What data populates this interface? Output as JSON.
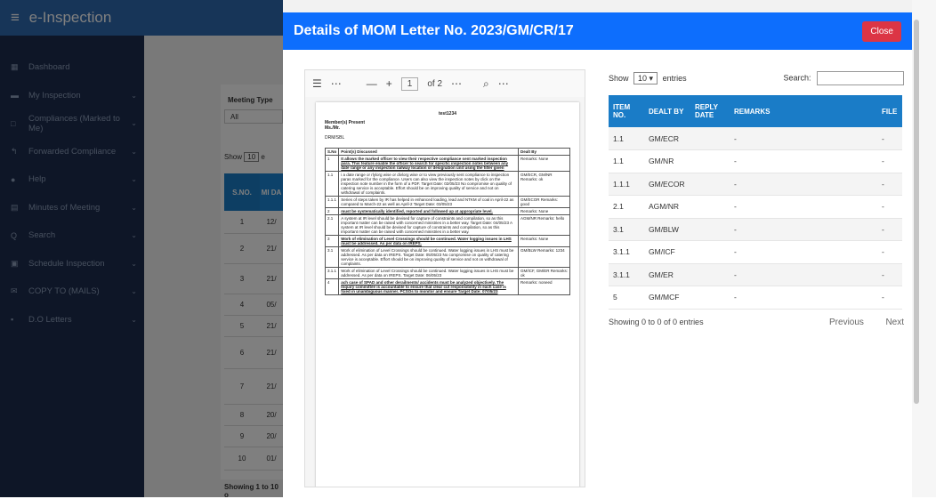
{
  "app": {
    "title": "e-Inspection",
    "menu_glyph": "≡"
  },
  "sidebar": {
    "items": [
      {
        "label": "Dashboard",
        "icon": "▦",
        "chevron": ""
      },
      {
        "label": "My Inspection",
        "icon": "▬",
        "chevron": "⌄"
      },
      {
        "label": "Compliances (Marked to Me)",
        "icon": "□",
        "chevron": "⌄"
      },
      {
        "label": "Forwarded Compliance",
        "icon": "↰",
        "chevron": "⌄"
      },
      {
        "label": "Help",
        "icon": "●",
        "chevron": "⌄"
      },
      {
        "label": "Minutes of Meeting",
        "icon": "▤",
        "chevron": "⌄"
      },
      {
        "label": "Search",
        "icon": "Q",
        "chevron": "⌄"
      },
      {
        "label": "Schedule Inspection",
        "icon": "▣",
        "chevron": "⌄"
      },
      {
        "label": "COPY TO (MAILS)",
        "icon": "✉",
        "chevron": "⌄"
      },
      {
        "label": "D.O Letters",
        "icon": "▪",
        "chevron": "⌄"
      }
    ]
  },
  "background": {
    "meeting_type_label": "Meeting Type",
    "meeting_type_value": "All",
    "show_label": "Show",
    "show_value": "10",
    "show_suffix": "e",
    "col_sno": "S.NO.",
    "col_meeting": "MI DA",
    "rows": [
      {
        "sno": "1",
        "date": "12/"
      },
      {
        "sno": "2",
        "date": "21/"
      },
      {
        "sno": "3",
        "date": "21/"
      },
      {
        "sno": "4",
        "date": "05/"
      },
      {
        "sno": "5",
        "date": "21/"
      },
      {
        "sno": "6",
        "date": "21/"
      },
      {
        "sno": "7",
        "date": "21/"
      },
      {
        "sno": "8",
        "date": "20/"
      },
      {
        "sno": "9",
        "date": "20/"
      },
      {
        "sno": "10",
        "date": "01/"
      }
    ],
    "footer": "Showing 1 to 10 o"
  },
  "modal": {
    "title": "Details of MOM Letter No. 2023/GM/CR/17",
    "close_label": "Close"
  },
  "pdf": {
    "page_value": "1",
    "page_total": "of 2",
    "doc_title": "test1234",
    "members_label": "Member(s) Present",
    "members_value": "Ms./Mr.",
    "dist": "DRM/SBL",
    "col_sno": "S.No",
    "col_points": "Point(s) Discussed",
    "col_dealt": "Dealt By",
    "rows": [
      {
        "no": "1",
        "text": "It allows the marked officer to view their respective compliance sent marked inspection para. This feature enable the officer to search for specific inspection notes between any date range or any inspection railway location or designation unit using the filter given",
        "dealt": "Remarks: None",
        "u": true
      },
      {
        "no": "1.1",
        "text": "i a date range or rlylorg wise or divlorg wise or to view previously sent compliance to inspection paras marked for the compliance. Users can also view the inspection notes by click on the inspection note number in the form of a PDF. Target Date: 02/05/23 No compromise on quality of catering service is acceptable. Effort should be on improving quality of service and not on withdrawal of complaints.",
        "dealt": "GM/ECR, GM/NR Remarks: ok",
        "u": false
      },
      {
        "no": "1.1.1",
        "text": "Series of steps taken by IR has helped in enhanced loading, lead and NTKM of coal in April-22 as compared to March-22 as well as April-2 Target Date: 03/05/23",
        "dealt": "GM/ECOR Remarks: good",
        "u": false
      },
      {
        "no": "2",
        "text": "must be systematically identified, reported and followed up at appropriate level.",
        "dealt": "Remarks: None",
        "u": true
      },
      {
        "no": "2.1",
        "text": "A system at IR level should be devised for capture of constraints and compilation, so as this important matter can be raised with concerned ministries in a better way. Target Date: 04/05/23 A system at IR level should be devised for capture of constraints and compilation, so as this important matter can be raised with concerned ministries in a better way.",
        "dealt": "AGM/NR Remarks: hello",
        "u": false
      },
      {
        "no": "3",
        "text": "Work of elimination of Level Crossings should be continued. Water logging issues in LHS must be addressed. As per data on IREPS.",
        "dealt": "Remarks: None",
        "u": true
      },
      {
        "no": "3.1",
        "text": "Work of elimination of Level Crossings should be continued. Water logging issues in LHS must be addressed. As per data on IREPS. Target Date: 05/05/23 No compromise on quality of catering service is acceptable. Effort should be on improving quality of service and not on withdrawal of complaints.",
        "dealt": "GM/BLW Remarks: 1234",
        "u": false
      },
      {
        "no": "3.1.1",
        "text": "Work of elimination of Level Crossings should be continued. Water logging issues in LHS must be addressed. As per data on IREPS. Target Date: 06/05/23",
        "dealt": "GM/ICF, GM/ER Remarks: ok",
        "u": false
      },
      {
        "no": "4",
        "text": "ach case of SPAD and other derailments/ accidents must be analyzed objectively. The Inquiry committee is accountable to ensure that clear cut responsibility in each case is fixed in unambiguous manner. PCSOs to monitor and ensure Target Date: 07/05/23",
        "dealt": "Remarks: noneed",
        "u": true
      }
    ]
  },
  "grid": {
    "show_label": "Show",
    "entries_value": "10",
    "entries_label": "entries",
    "search_label": "Search:",
    "headers": {
      "item": "ITEM NO.",
      "dealt": "DEALT BY",
      "reply": "REPLY DATE",
      "remarks": "REMARKS",
      "file": "FILE"
    },
    "rows": [
      {
        "item": "1.1",
        "dealt": "GM/ECR",
        "reply": "",
        "remarks": "-",
        "file": "-"
      },
      {
        "item": "1.1",
        "dealt": "GM/NR",
        "reply": "",
        "remarks": "-",
        "file": "-"
      },
      {
        "item": "1.1.1",
        "dealt": "GM/ECOR",
        "reply": "",
        "remarks": "-",
        "file": "-"
      },
      {
        "item": "2.1",
        "dealt": "AGM/NR",
        "reply": "",
        "remarks": "-",
        "file": "-"
      },
      {
        "item": "3.1",
        "dealt": "GM/BLW",
        "reply": "",
        "remarks": "-",
        "file": "-"
      },
      {
        "item": "3.1.1",
        "dealt": "GM/ICF",
        "reply": "",
        "remarks": "-",
        "file": "-"
      },
      {
        "item": "3.1.1",
        "dealt": "GM/ER",
        "reply": "",
        "remarks": "-",
        "file": "-"
      },
      {
        "item": "5",
        "dealt": "GM/MCF",
        "reply": "",
        "remarks": "-",
        "file": "-"
      }
    ],
    "info": "Showing 0 to 0 of 0 entries",
    "prev": "Previous",
    "next": "Next"
  }
}
